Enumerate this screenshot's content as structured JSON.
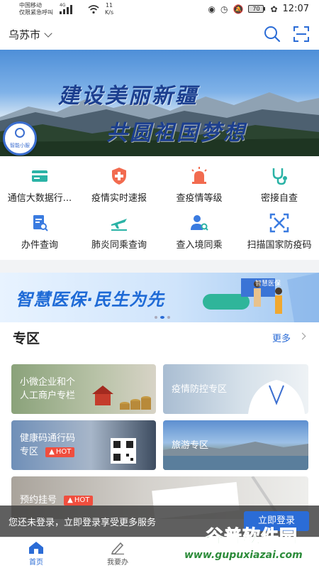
{
  "status_bar": {
    "carrier": "中国移动",
    "emergency": "仅限紧急呼叫",
    "net": "4G",
    "speed_value": "11",
    "speed_unit": "K/s",
    "battery": "70",
    "time": "12:07"
  },
  "header": {
    "city": "乌苏市",
    "search_icon": "search-icon",
    "scan_icon": "scan-icon"
  },
  "banner": {
    "line1": "建设美丽新疆",
    "line2": "共圆祖国梦想",
    "assistant_label": "智能小服"
  },
  "services": [
    {
      "label": "通信大数据行...",
      "icon": "card-icon",
      "color": "#2bb3a6"
    },
    {
      "label": "疫情实时速报",
      "icon": "shield-plus-icon",
      "color": "#f26b4f"
    },
    {
      "label": "查疫情等级",
      "icon": "alarm-icon",
      "color": "#f26b4f"
    },
    {
      "label": "密接自查",
      "icon": "stethoscope-icon",
      "color": "#2bb3a6"
    },
    {
      "label": "办件查询",
      "icon": "doc-search-icon",
      "color": "#3a7be0"
    },
    {
      "label": "肺炎同乘查询",
      "icon": "plane-icon",
      "color": "#2bb3a6"
    },
    {
      "label": "查入境同乘",
      "icon": "person-search-icon",
      "color": "#3a7be0"
    },
    {
      "label": "扫描国家防疫码",
      "icon": "qr-scan-icon",
      "color": "#3a7be0"
    }
  ],
  "promo": {
    "text": "智慧医保·民生为先",
    "badge": "智慧医保"
  },
  "zone": {
    "title": "专区",
    "more": "更多",
    "cards": [
      {
        "label_line1": "小微企业和个",
        "label_line2": "人工商户专栏"
      },
      {
        "label_line1": "疫情防控专区"
      },
      {
        "label_line1": "健康码通行码",
        "label_line2": "专区",
        "hot": "HOT"
      },
      {
        "label_line1": "旅游专区"
      },
      {
        "label_line1": "预约挂号",
        "hot": "HOT"
      }
    ]
  },
  "login_toast": {
    "text": "您还未登录，立即登录享受更多服务",
    "button": "立即登录"
  },
  "bottom_nav": [
    {
      "label": "首页",
      "active": true
    },
    {
      "label": "我要办",
      "active": false
    }
  ],
  "watermark": {
    "title": "谷普软件园",
    "url": "www.gupuxiazai.com"
  }
}
